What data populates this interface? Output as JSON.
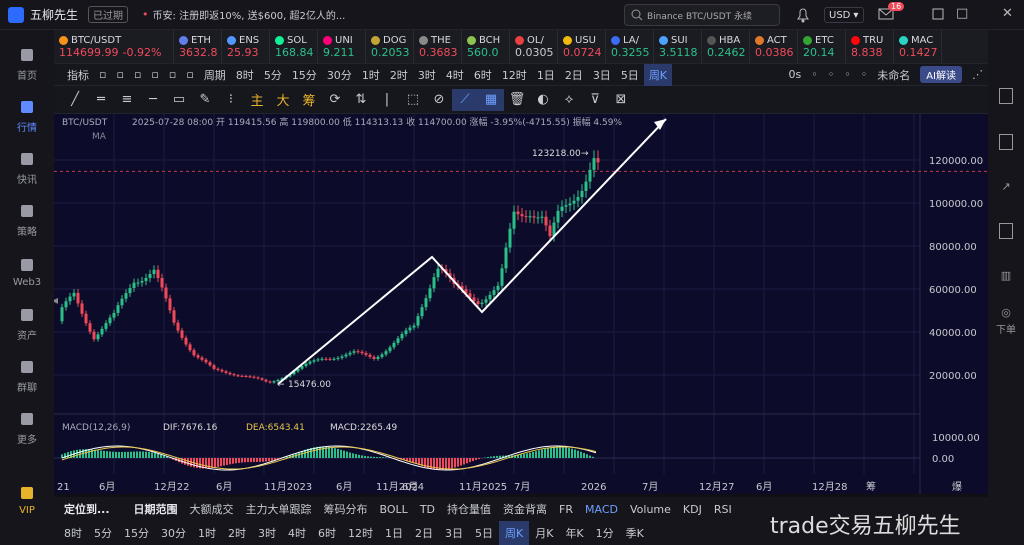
{
  "app": {
    "title": "五柳先生",
    "status_badge": "已过期"
  },
  "banner": {
    "text": "币安: 注册即返10%, 送$600, 超2亿人的..."
  },
  "search": {
    "value": "Binance BTC/USDT 永续"
  },
  "currency": "USD",
  "mail_badge": "16",
  "leftnav": [
    {
      "label": "首页",
      "icon": "home-icon"
    },
    {
      "label": "行情",
      "icon": "chart-bars-icon"
    },
    {
      "label": "快讯",
      "icon": "news-icon"
    },
    {
      "label": "策略",
      "icon": "robot-icon"
    },
    {
      "label": "Web3",
      "icon": "web3-icon"
    },
    {
      "label": "资产",
      "icon": "wallet-icon"
    },
    {
      "label": "群聊",
      "icon": "chat-icon"
    },
    {
      "label": "更多",
      "icon": "grid-icon"
    },
    {
      "label": "VIP",
      "icon": "vip-icon"
    }
  ],
  "rightnav": {
    "download_label": "下单"
  },
  "tickers": [
    {
      "name": "BTC/USDT",
      "price": "114699.99",
      "change": "-0.92%",
      "dir": "dn",
      "color": "#f7931a"
    },
    {
      "name": "ETH",
      "price": "3632.8",
      "dir": "dn",
      "color": "#627eea"
    },
    {
      "name": "ENS",
      "price": "25.93",
      "dir": "dn",
      "color": "#5298ff"
    },
    {
      "name": "SOL",
      "price": "168.84",
      "dir": "up",
      "color": "#14f195"
    },
    {
      "name": "UNI",
      "price": "9.211",
      "dir": "up",
      "color": "#ff007a"
    },
    {
      "name": "DOG",
      "price": "0.2053",
      "dir": "up",
      "color": "#c2a633"
    },
    {
      "name": "THE",
      "price": "0.3683",
      "dir": "dn",
      "color": "#8a8a8a"
    },
    {
      "name": "BCH",
      "price": "560.0",
      "dir": "up",
      "color": "#8dc351"
    },
    {
      "name": "OL/",
      "price": "0.0305",
      "dir": "nt",
      "color": "#e84142"
    },
    {
      "name": "USU",
      "price": "0.0724",
      "dir": "dn",
      "color": "#f0b90b"
    },
    {
      "name": "LA/",
      "price": "0.3255",
      "dir": "up",
      "color": "#3b6cf5"
    },
    {
      "name": "SUI",
      "price": "3.5118",
      "dir": "up",
      "color": "#4da2ff"
    },
    {
      "name": "HBA",
      "price": "0.2462",
      "dir": "up",
      "color": "#555555"
    },
    {
      "name": "ACT",
      "price": "0.0386",
      "dir": "dn",
      "color": "#e07a2a"
    },
    {
      "name": "ETC",
      "price": "20.14",
      "dir": "up",
      "color": "#33a532"
    },
    {
      "name": "TRU",
      "price": "8.838",
      "dir": "dn",
      "color": "#ff060a"
    },
    {
      "name": "MAC",
      "price": "0.1427",
      "dir": "dn",
      "color": "#2bd3c3"
    }
  ],
  "tfbar": {
    "indicator": "指标",
    "period": "周期",
    "items": [
      "8时",
      "5分",
      "15分",
      "30分",
      "1时",
      "2时",
      "3时",
      "4时",
      "6时",
      "12时",
      "1日",
      "2日",
      "3日",
      "5日",
      "周K"
    ],
    "selected": "周K",
    "right_items": [
      "0s"
    ],
    "layout_name": "未命名",
    "ai": "AI解读"
  },
  "drawtools": [
    "主",
    "大",
    "筹"
  ],
  "chart": {
    "symbol": "BTC/USDT",
    "ohlc_line": "2025-07-28 08:00 开 119415.56 高 119800.00 低 114313.13 收 114700.00 涨幅 -3.95%(-4715.55) 振幅 4.59%",
    "ma_label": "MA",
    "macd_label": "MACD(12,26,9)",
    "dif": "DIF:7676.16",
    "dea": "DEA:6543.41",
    "macd": "MACD:2265.49",
    "high_label": "123218.00",
    "low_label": "15476.00",
    "current_price": "114700.00",
    "price_ticks": [
      "120000.00",
      "100000.00",
      "80000.00",
      "60000.00",
      "40000.00",
      "20000.00"
    ],
    "macd_ticks": [
      "10000.00",
      "0.00"
    ],
    "time_ticks": [
      "21",
      "6月",
      "12月22",
      "6月",
      "11月2023",
      "6月",
      "11月2024",
      "6月",
      "11月2025",
      "7月",
      "2026",
      "7月",
      "12月27",
      "6月",
      "12月28",
      "筹",
      "爆"
    ]
  },
  "chart_data": {
    "type": "candlestick",
    "title": "BTC/USDT",
    "interval": "weekly",
    "ylim": [
      0,
      130000
    ],
    "annotations": [
      {
        "label": "15476.00",
        "type": "low"
      },
      {
        "label": "123218.00",
        "type": "high"
      }
    ],
    "path_points": [
      {
        "x": "2022-11",
        "y": 15476
      },
      {
        "x": "2024-03",
        "y": 73000
      },
      {
        "x": "2024-08",
        "y": 50000
      },
      {
        "x": "2025-07",
        "y": 114700
      }
    ]
  },
  "bottom1": {
    "locate": "定位到...",
    "range": "日期范围",
    "items": [
      "大额成交",
      "主力大单跟踪",
      "筹码分布",
      "BOLL",
      "TD",
      "持仓量值",
      "资金背离",
      "FR",
      "MACD",
      "Volume",
      "KDJ",
      "RSI"
    ],
    "selected": "MACD"
  },
  "bottom2": {
    "items": [
      "8时",
      "5分",
      "15分",
      "30分",
      "1时",
      "2时",
      "3时",
      "4时",
      "6时",
      "12时",
      "1日",
      "2日",
      "3日",
      "5日",
      "周K",
      "月K",
      "年K",
      "1分",
      "季K"
    ],
    "selected": "周K"
  },
  "watermark": "trade交易五柳先生"
}
